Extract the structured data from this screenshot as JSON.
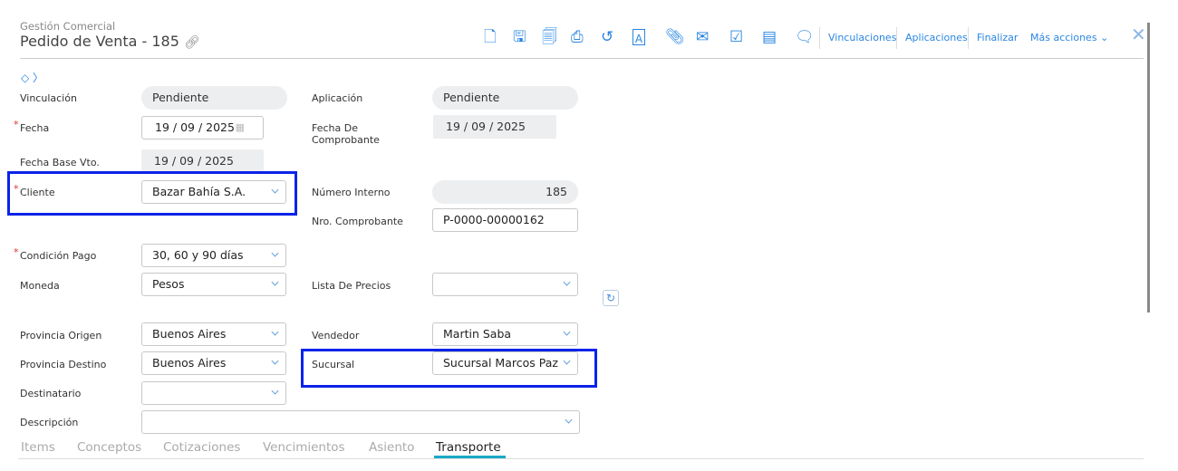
{
  "header": {
    "module": "Gestión Comercial",
    "title": "Pedido de Venta - 185"
  },
  "toolbar": {
    "actions": [
      "Vinculaciones",
      "Aplicaciones",
      "Finalizar",
      "Más acciones"
    ],
    "icons": [
      "new-document-icon",
      "save-icon",
      "copy-icon",
      "print-icon",
      "history-icon",
      "text-document-icon",
      "attachment-icon",
      "email-icon",
      "checklist-icon",
      "notebook-icon",
      "comment-icon"
    ]
  },
  "form": {
    "vinculacion": {
      "label": "Vinculación",
      "value": "Pendiente"
    },
    "aplicacion": {
      "label": "Aplicación",
      "value": "Pendiente"
    },
    "fecha": {
      "label": "Fecha",
      "value": "19 / 09 / 2025"
    },
    "fecha_comprobante": {
      "label": "Fecha De Comprobante",
      "value": "19 / 09 / 2025"
    },
    "fecha_base_vto": {
      "label": "Fecha Base Vto.",
      "value": "19 / 09 / 2025"
    },
    "cliente": {
      "label": "Cliente",
      "value": "Bazar Bahía S.A."
    },
    "numero_interno": {
      "label": "Número Interno",
      "value": "185"
    },
    "nro_comprobante": {
      "label": "Nro. Comprobante",
      "value": "P-0000-00000162"
    },
    "condicion_pago": {
      "label": "Condición Pago",
      "value": "30, 60 y 90 días"
    },
    "moneda": {
      "label": "Moneda",
      "value": "Pesos"
    },
    "lista_precios": {
      "label": "Lista De Precios",
      "value": ""
    },
    "provincia_origen": {
      "label": "Provincia Origen",
      "value": "Buenos Aires"
    },
    "vendedor": {
      "label": "Vendedor",
      "value": "Martin Saba"
    },
    "provincia_destino": {
      "label": "Provincia Destino",
      "value": "Buenos Aires"
    },
    "sucursal": {
      "label": "Sucursal",
      "value": "Sucursal Marcos Paz"
    },
    "destinatario": {
      "label": "Destinatario",
      "value": ""
    },
    "descripcion": {
      "label": "Descripción",
      "value": ""
    }
  },
  "tabs": [
    "Items",
    "Conceptos",
    "Cotizaciones",
    "Vencimientos",
    "Asiento",
    "Transporte"
  ],
  "active_tab": "Transporte",
  "colors": {
    "accent": "#2a86e0",
    "highlight": "#0b23e8",
    "tab_underline": "#1ba8c8"
  }
}
